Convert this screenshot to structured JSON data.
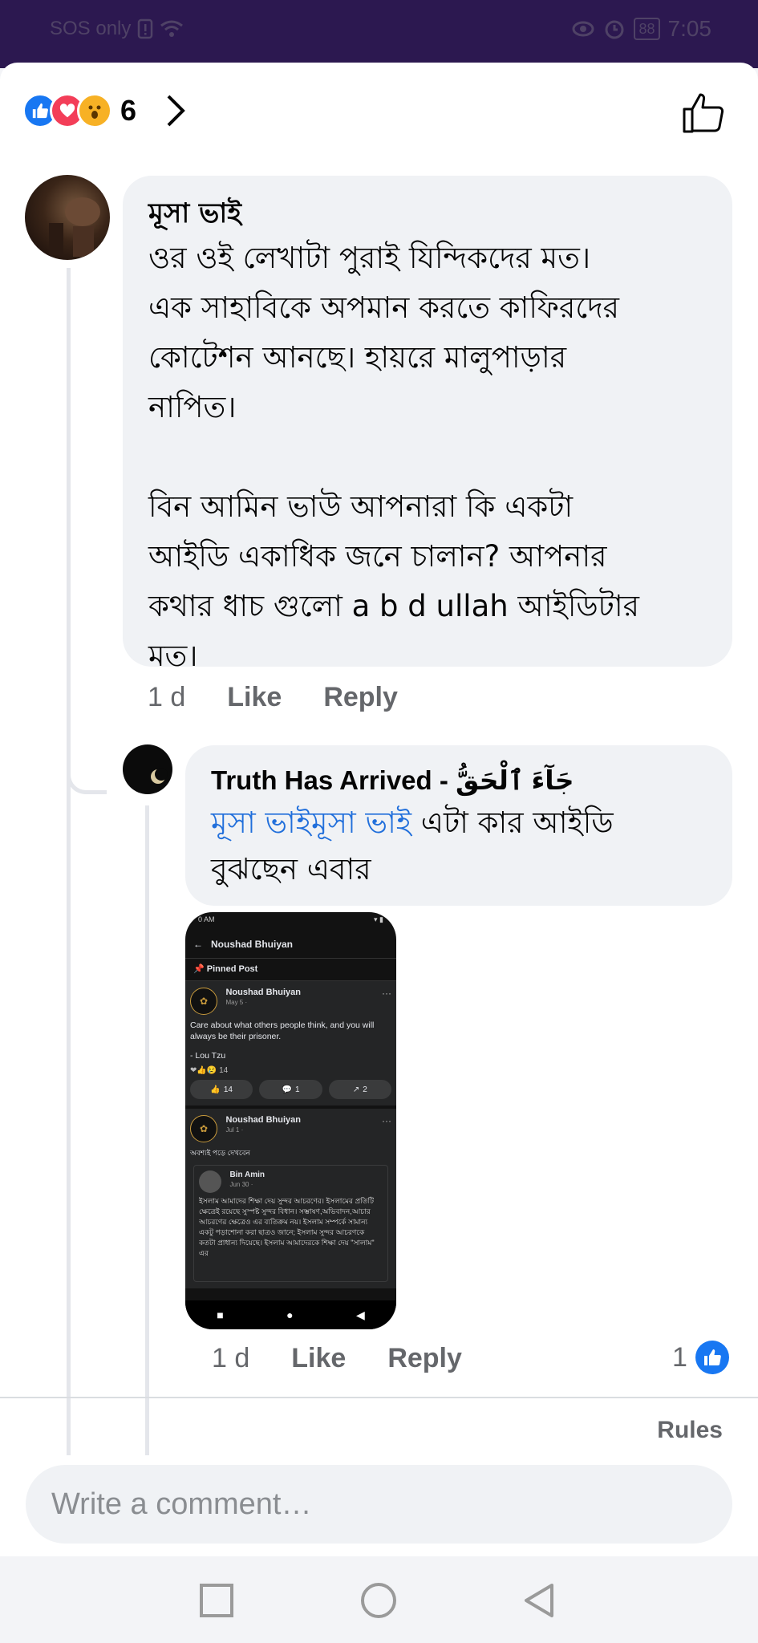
{
  "status_bar": {
    "left_text": "SOS only",
    "battery": "88",
    "time": "7:05"
  },
  "reactions": {
    "count": "6",
    "icons": [
      "like-icon",
      "love-icon",
      "wow-icon"
    ]
  },
  "comments": [
    {
      "author": "মূসা ভাই",
      "text_lines": [
        "ওর ওই লেখাটা পুরাই যিন্দিকদের মত।",
        "এক সাহাবিকে অপমান করতে কাফিরদের",
        "কোটেশন আনছে।  হায়রে মালুপাড়ার",
        "নাপিত।",
        "",
        "বিন আমিন ভাউ আপনারা কি একটা",
        "আইডি একাধিক জনে চালান? আপনার",
        "কথার ধাচ গুলো a b d ullah আইডিটার",
        "মত।"
      ],
      "time": "1 d",
      "like_label": "Like",
      "reply_label": "Reply"
    },
    {
      "author": "Truth Has Arrived - جَآءَ ٱلْحَقُّ",
      "mention": "মূসা ভাইমূসা ভাই",
      "text_after_mention": " এটা কার আইডি",
      "text_line2": "বুঝছেন এবার",
      "time": "1 d",
      "like_label": "Like",
      "reply_label": "Reply",
      "like_count": "1"
    }
  ],
  "attached_screenshot": {
    "status_time": "0 AM",
    "header_title": "Noushad Bhuiyan",
    "pinned_label": "Pinned Post",
    "post1": {
      "name": "Noushad Bhuiyan",
      "date": "May 5 · ",
      "text": "Care about what others people think, and you will always be their prisoner.",
      "quote_author": "- Lou Tzu",
      "reaction_count": "14",
      "likes": "14",
      "comments": "1",
      "shares": "2"
    },
    "post2": {
      "name": "Noushad Bhuiyan",
      "date": "Jul 1 · ",
      "text": "অবশ্যই পড়ে দেখবেন",
      "inner_name": "Bin Amin",
      "inner_date": "Jun 30 · ",
      "inner_text": "ইসলাম আমাদের শিক্ষা দেয় সুন্দর আচরণের। ইসলামের প্রতিটি ক্ষেত্রেই রয়েছে সুস্পষ্ট সুন্দর বিধান। সম্ভাষণ,অভিবাদন,আচার আচরণের ক্ষেত্রেও এর ব্যতিক্রম নয়। ইসলাম সম্পর্কে সামান্য একটু পড়াশোনা করা ছাত্রও জানে; ইসলাম সুন্দর আচরণকে কতটা প্রাধান্য দিয়েছে। ইসলাম আমাদেরকে শিক্ষা দেয় \"সালাম\" এর"
    }
  },
  "footer": {
    "rules_label": "Rules",
    "comment_placeholder": "Write a comment…"
  },
  "colors": {
    "accent": "#1877f2",
    "status_bar_bg": "#2c1850",
    "bubble_bg": "#f0f2f5",
    "meta_text": "#65676b",
    "mention": "#216fdb"
  }
}
